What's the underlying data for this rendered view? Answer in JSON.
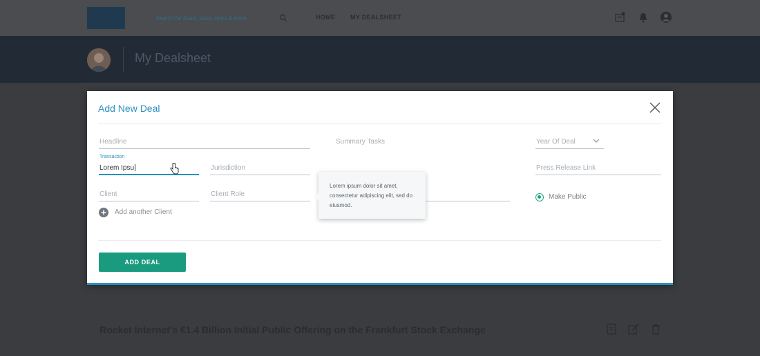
{
  "nav": {
    "search_placeholder": "Search for deals, case, client & more",
    "links": [
      "HOME",
      "MY DEALSHEET"
    ]
  },
  "subheader": {
    "title": "My Dealsheet"
  },
  "modal": {
    "title": "Add New Deal",
    "fields": {
      "headline_placeholder": "Headline",
      "transaction_label": "Transaction",
      "transaction_value": "Lorem Ipsu",
      "jurisdiction_placeholder": "Jurisdiction",
      "client_placeholder": "Client",
      "client_role_placeholder": "Client Role",
      "summary_tasks_label": "Summary Tasks",
      "year_placeholder": "Year Of Deal",
      "press_release_placeholder": "Press Release Link"
    },
    "add_client_label": "Add another Client",
    "make_public_label": "Make Public",
    "tooltip_text": "Lorem ipsum dolor sit amet, consectetur adipiscing elit, sed do eiusmod.",
    "add_button_label": "ADD DEAL"
  },
  "background": {
    "article_title": "Rocket Internet's €1.4 Billion Initial Public Offering on the Frankfurt Stock Exchange"
  },
  "colors": {
    "accent": "#2a8fc0",
    "button": "#1a9a7e",
    "radio": "#1fa27f"
  }
}
